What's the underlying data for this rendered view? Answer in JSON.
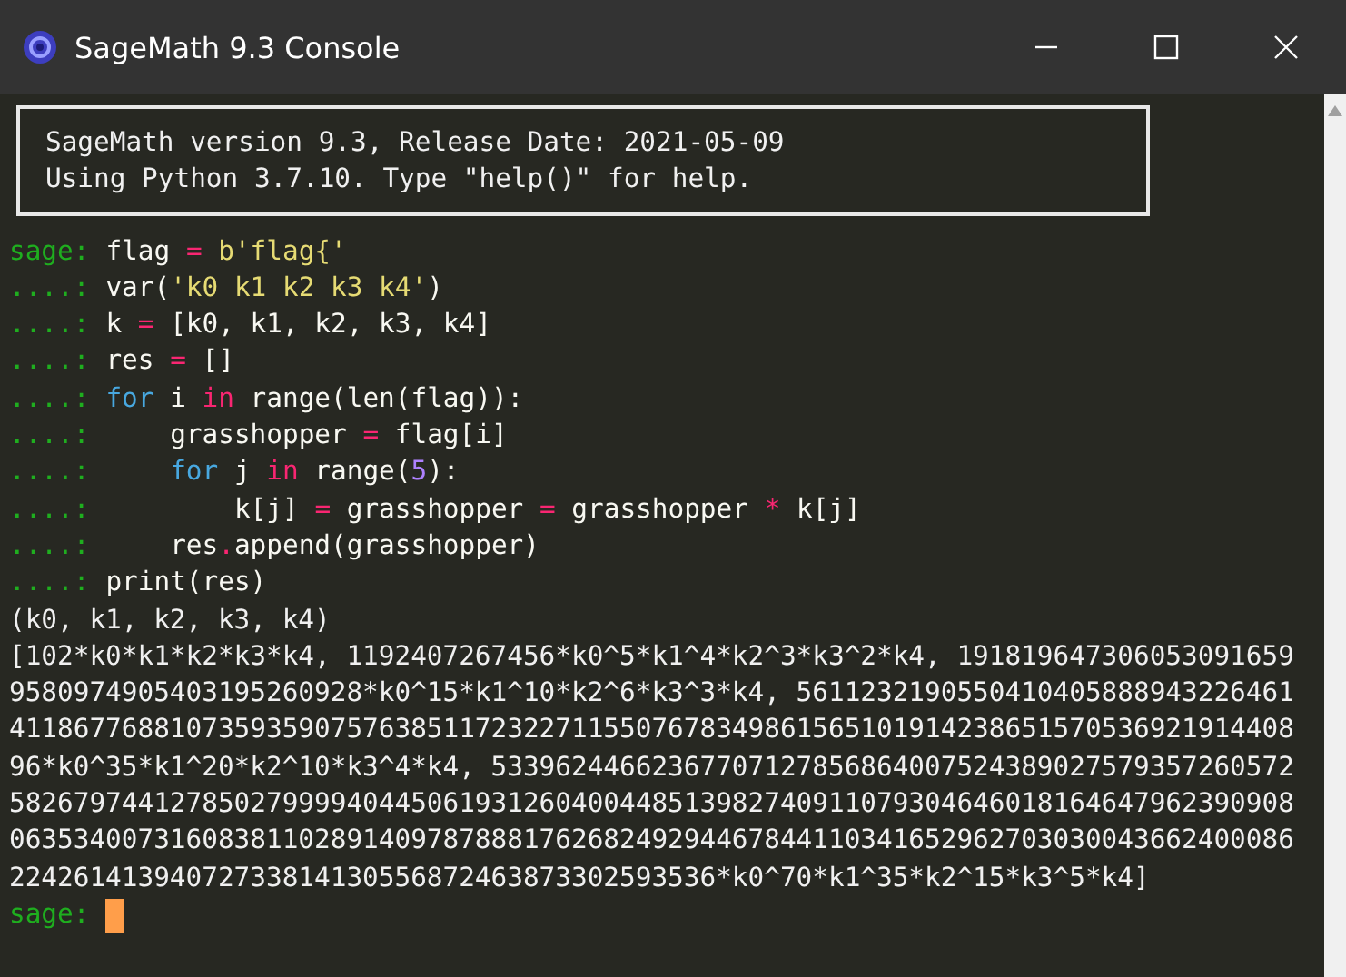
{
  "window": {
    "title": "SageMath 9.3 Console"
  },
  "banner": [
    "SageMath version 9.3, Release Date: 2021-05-09",
    "Using Python 3.7.10. Type \"help()\" for help."
  ],
  "input_lines": [
    {
      "prompt": "sage:",
      "tokens": [
        {
          "text": "flag ",
          "kind": "plain"
        },
        {
          "text": "=",
          "kind": "operator"
        },
        {
          "text": " b'flag{'",
          "kind": "string"
        }
      ]
    },
    {
      "prompt": "....:",
      "tokens": [
        {
          "text": "var(",
          "kind": "plain"
        },
        {
          "text": "'k0 k1 k2 k3 k4'",
          "kind": "string"
        },
        {
          "text": ")",
          "kind": "plain"
        }
      ]
    },
    {
      "prompt": "....:",
      "tokens": [
        {
          "text": "k ",
          "kind": "plain"
        },
        {
          "text": "=",
          "kind": "operator"
        },
        {
          "text": " [k0, k1, k2, k3, k4]",
          "kind": "plain"
        }
      ]
    },
    {
      "prompt": "....:",
      "tokens": [
        {
          "text": "res ",
          "kind": "plain"
        },
        {
          "text": "=",
          "kind": "operator"
        },
        {
          "text": " []",
          "kind": "plain"
        }
      ]
    },
    {
      "prompt": "....:",
      "tokens": [
        {
          "text": "for",
          "kind": "keyword"
        },
        {
          "text": " i ",
          "kind": "plain"
        },
        {
          "text": "in",
          "kind": "operator"
        },
        {
          "text": " range(len(flag)):",
          "kind": "plain"
        }
      ]
    },
    {
      "prompt": "....:",
      "tokens": [
        {
          "text": "    grasshopper ",
          "kind": "plain"
        },
        {
          "text": "=",
          "kind": "operator"
        },
        {
          "text": " flag[i]",
          "kind": "plain"
        }
      ]
    },
    {
      "prompt": "....:",
      "tokens": [
        {
          "text": "    for",
          "kind": "keyword"
        },
        {
          "text": " j ",
          "kind": "plain"
        },
        {
          "text": "in",
          "kind": "operator"
        },
        {
          "text": " range(",
          "kind": "plain"
        },
        {
          "text": "5",
          "kind": "number"
        },
        {
          "text": "):",
          "kind": "plain"
        }
      ]
    },
    {
      "prompt": "....:",
      "tokens": [
        {
          "text": "        k[j] ",
          "kind": "plain"
        },
        {
          "text": "=",
          "kind": "operator"
        },
        {
          "text": " grasshopper ",
          "kind": "plain"
        },
        {
          "text": "=",
          "kind": "operator"
        },
        {
          "text": " grasshopper ",
          "kind": "plain"
        },
        {
          "text": "*",
          "kind": "operator"
        },
        {
          "text": " k[j]",
          "kind": "plain"
        }
      ]
    },
    {
      "prompt": "....:",
      "tokens": [
        {
          "text": "    res",
          "kind": "plain"
        },
        {
          "text": ".",
          "kind": "operator"
        },
        {
          "text": "append(grasshopper)",
          "kind": "plain"
        }
      ]
    },
    {
      "prompt": "....:",
      "tokens": [
        {
          "text": "print(res)",
          "kind": "plain"
        }
      ]
    }
  ],
  "output_lines": [
    "(k0, k1, k2, k3, k4)",
    "[102*k0*k1*k2*k3*k4, 1192407267456*k0^5*k1^4*k2^3*k3^2*k4, 191819647306053091659",
    "9580974905403195260928*k0^15*k1^10*k2^6*k3^3*k4, 5611232190550410405888943226461",
    "41186776881073593590757638511723227115507678349861565101914238651570536921914408",
    "96*k0^35*k1^20*k2^10*k3^4*k4, 53396244662367707127856864007524389027579357260572",
    "58267974412785027999940445061931260400448513982740911079304646018164647962390908",
    "06353400731608381102891409787888176268249294467844110341652962703030043662400086",
    "22426141394072733814130556872463873302593536*k0^70*k1^35*k2^15*k3^5*k4]"
  ],
  "final_prompt": "sage:"
}
